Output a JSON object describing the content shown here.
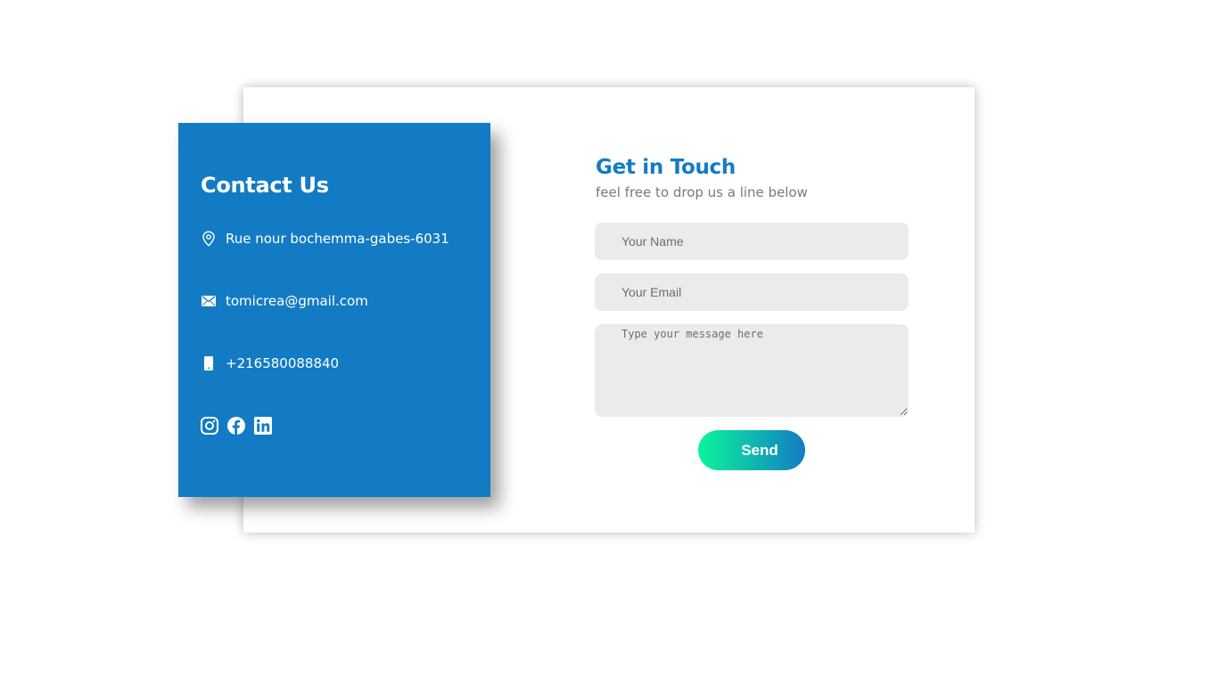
{
  "contact": {
    "title": "Contact Us",
    "address": "Rue nour bochemma-gabes-6031",
    "email": "tomicrea@gmail.com",
    "phone": "+216580088840",
    "icons": {
      "address": "map-pin-icon",
      "email": "envelope-icon",
      "phone": "mobile-phone-icon"
    },
    "socials": [
      "instagram-icon",
      "facebook-icon",
      "linkedin-icon"
    ]
  },
  "form": {
    "title": "Get in Touch",
    "subtitle": "feel free to drop us a line below",
    "name_placeholder": "Your Name",
    "email_placeholder": "Your Email",
    "message_placeholder": "Type your message here",
    "send_label": "Send"
  },
  "colors": {
    "primary": "#137bc4",
    "button_gradient_start": "#0cf59a",
    "button_gradient_end": "#137bc4",
    "field_bg": "#ebebeb"
  }
}
